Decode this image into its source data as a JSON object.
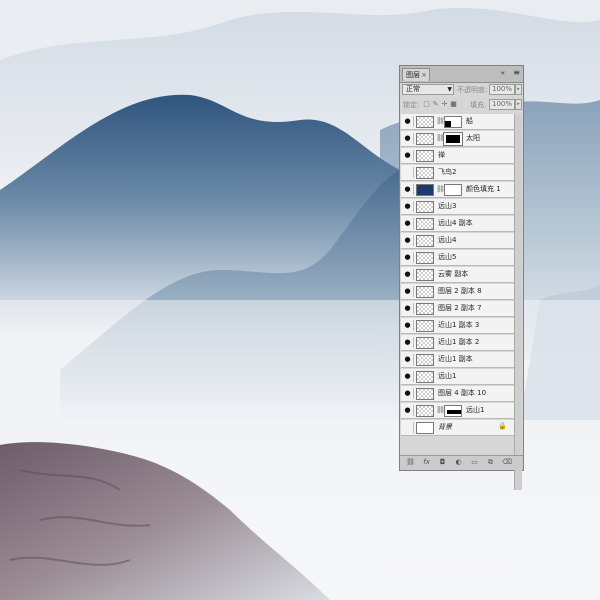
{
  "layers_panel": {
    "tab_label": "图层",
    "tab_close": "×",
    "collapse_glyph": "«",
    "menu_glyph": "≡",
    "blend_mode": "正常",
    "opacity_label": "不透明度:",
    "opacity_value": "100%",
    "lock_label": "锁定:",
    "fill_label": "填充:",
    "fill_value": "100%",
    "layers": [
      {
        "name": "船",
        "visible": true
      },
      {
        "name": "太阳",
        "visible": true
      },
      {
        "name": "禅",
        "visible": true
      },
      {
        "name": "飞鸟2",
        "visible": false
      },
      {
        "name": "颜色填充 1",
        "visible": true,
        "fill_color": "#1c3a6e"
      },
      {
        "name": "远山3",
        "visible": true
      },
      {
        "name": "远山4 副本",
        "visible": true
      },
      {
        "name": "远山4",
        "visible": true
      },
      {
        "name": "远山5",
        "visible": true
      },
      {
        "name": "云雾 副本",
        "visible": true
      },
      {
        "name": "图层 2 副本 8",
        "visible": true
      },
      {
        "name": "图层 2 副本 7",
        "visible": true
      },
      {
        "name": "近山1 副本 3",
        "visible": true
      },
      {
        "name": "近山1 副本 2",
        "visible": true
      },
      {
        "name": "近山1 副本",
        "visible": true
      },
      {
        "name": "远山1",
        "visible": true
      },
      {
        "name": "图层 4 副本 10",
        "visible": true
      },
      {
        "name": "远山1",
        "visible": true
      },
      {
        "name": "背景",
        "visible": false,
        "locked": true
      }
    ],
    "bottom_icons": [
      "link-icon",
      "fx-icon",
      "add-mask-icon",
      "adjustment-icon",
      "group-folder-icon",
      "new-layer-icon",
      "trash-icon"
    ]
  },
  "colors": {
    "sky": "#eef1f5",
    "mountain_dark": "#3a5f85",
    "mountain_mid": "#6f8ea9",
    "rock": "#7e6f78"
  }
}
